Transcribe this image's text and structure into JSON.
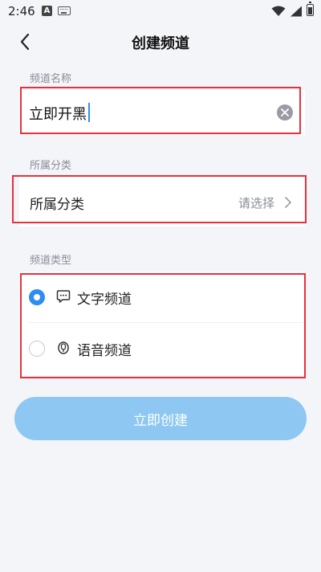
{
  "status_bar": {
    "time": "2:46",
    "notification_letter": "A"
  },
  "header": {
    "title": "创建频道"
  },
  "channel_name": {
    "section_label": "频道名称",
    "value": "立即开黑"
  },
  "category": {
    "section_label": "所属分类",
    "row_label": "所属分类",
    "placeholder": "请选择"
  },
  "channel_type": {
    "section_label": "频道类型",
    "options": [
      {
        "label": "文字频道",
        "icon": "chat-bubble-icon",
        "selected": true
      },
      {
        "label": "语音频道",
        "icon": "microphone-icon",
        "selected": false
      }
    ]
  },
  "submit": {
    "label": "立即创建"
  },
  "colors": {
    "accent": "#2b8ef0",
    "button_disabled": "#8ec7f1",
    "highlight_box": "#e8303d",
    "background": "#f4f5f9"
  }
}
